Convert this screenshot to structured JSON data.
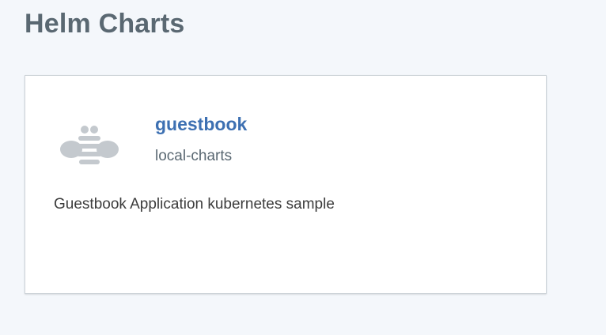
{
  "page": {
    "title": "Helm Charts"
  },
  "charts": [
    {
      "name": "guestbook",
      "repo": "local-charts",
      "description": "Guestbook Application kubernetes sample",
      "icon": "helm-bee-icon"
    }
  ],
  "colors": {
    "background": "#f4f7fb",
    "title": "#5a6872",
    "link": "#3d70b2",
    "icon": "#c4c9ce"
  }
}
